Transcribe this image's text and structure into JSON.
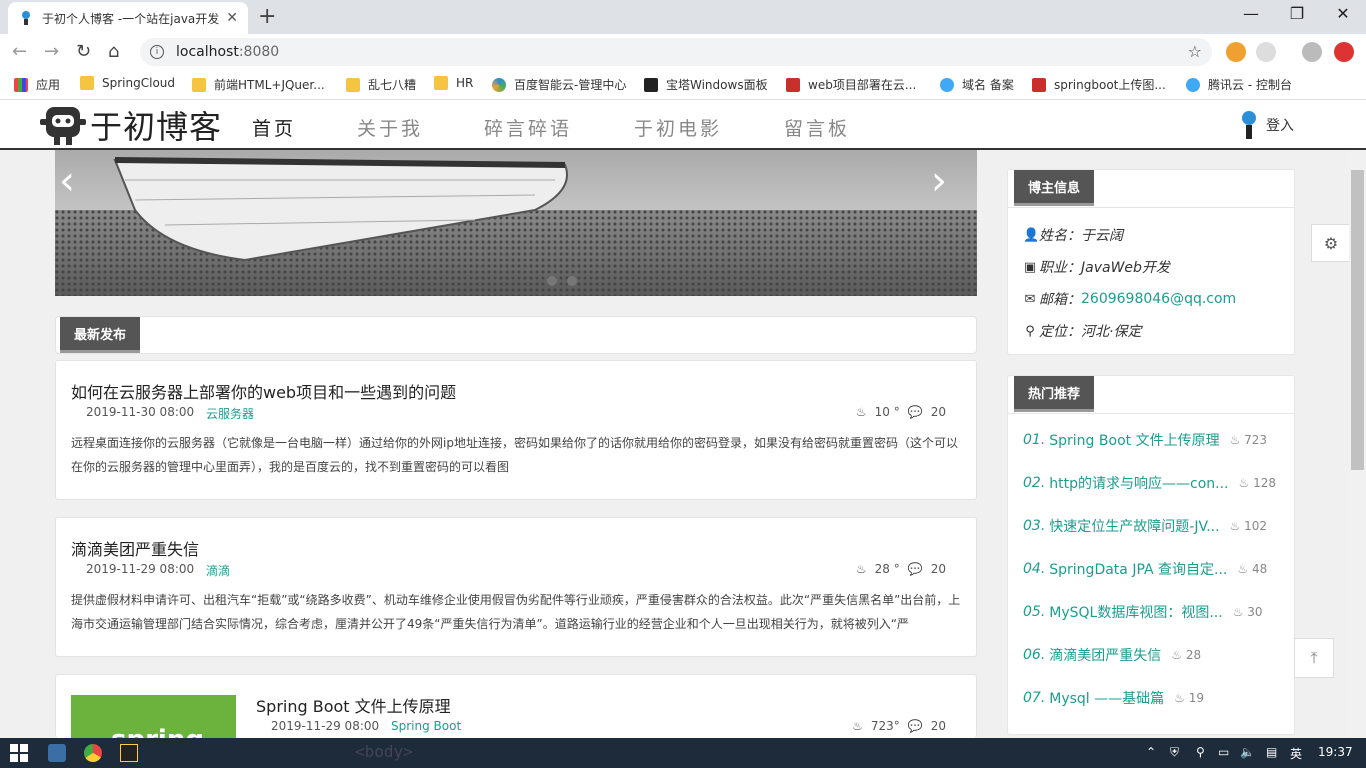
{
  "browser": {
    "tab_title": "于初个人博客 -一个站在java开发",
    "url_host": "localhost",
    "url_port": ":8080",
    "bookmarks": [
      {
        "label": "应用",
        "icon": "apps-grid-icon"
      },
      {
        "label": "SpringCloud",
        "icon": "folder-icon"
      },
      {
        "label": "前端HTML+JQuer...",
        "icon": "folder-icon"
      },
      {
        "label": "乱七八糟",
        "icon": "folder-icon"
      },
      {
        "label": "HR",
        "icon": "folder-icon"
      },
      {
        "label": "百度智能云-管理中心",
        "icon": "baidu-cloud-icon"
      },
      {
        "label": "宝塔Windows面板",
        "icon": "bt-icon"
      },
      {
        "label": "web项目部署在云...",
        "icon": "csdn-icon"
      },
      {
        "label": "域名 备案",
        "icon": "cloud-icon"
      },
      {
        "label": "springboot上传图...",
        "icon": "csdn-icon"
      },
      {
        "label": "腾讯云 - 控制台",
        "icon": "cloud-icon"
      }
    ]
  },
  "site": {
    "logo_text": "于初博客",
    "nav": [
      "首页",
      "关于我",
      "碎言碎语",
      "于初电影",
      "留言板"
    ],
    "login": "登入",
    "section_title": "最新发布",
    "articles": [
      {
        "title": "如何在云服务器上部署你的web项目和一些遇到的问题",
        "date": "2019-11-30 08:00",
        "category": "云服务器",
        "views": "10 °",
        "comments": "20",
        "body": "远程桌面连接你的云服务器（它就像是一台电脑一样）通过给你的外网ip地址连接，密码如果给你了的话你就用给你的密码登录，如果没有给密码就重置密码（这个可以在你的云服务器的管理中心里面弄），我的是百度云的，找不到重置密码的可以看图"
      },
      {
        "title": "滴滴美团严重失信",
        "date": "2019-11-29 08:00",
        "category": "滴滴",
        "views": "28 °",
        "comments": "20",
        "body": "提供虚假材料申请许可、出租汽车“拒载”或“绕路多收费”、机动车维修企业使用假冒伪劣配件等行业顽疾，严重侵害群众的合法权益。此次“严重失信黑名单”出台前，上海市交通运输管理部门结合实际情况，综合考虑，厘清并公开了49条“严重失信行为清单”。道路运输行业的经营企业和个人一旦出现相关行为，就将被列入“严"
      },
      {
        "title": "Spring Boot 文件上传原理",
        "date": "2019-11-29 08:00",
        "category": "Spring Boot",
        "views": "723°",
        "comments": "20",
        "thumb_text": "spring"
      }
    ]
  },
  "sidebar": {
    "blogger_title": "博主信息",
    "info": [
      {
        "icon": "user-icon",
        "text": "姓名：于云阔"
      },
      {
        "icon": "idcard-icon",
        "text": "职业：JavaWeb开发"
      },
      {
        "icon": "mail-icon",
        "text": "邮箱：",
        "link": "2609698046@qq.com"
      },
      {
        "icon": "location-icon",
        "text": "定位：河北·保定"
      }
    ],
    "hot_title": "热门推荐",
    "hot": [
      {
        "num": "01.",
        "text": "Spring Boot 文件上传原理",
        "count": "723"
      },
      {
        "num": "02.",
        "text": "http的请求与响应——con...",
        "count": "128"
      },
      {
        "num": "03.",
        "text": "快速定位生产故障问题-JV...",
        "count": "102"
      },
      {
        "num": "04.",
        "text": "SpringData JPA 查询自定...",
        "count": "48"
      },
      {
        "num": "05.",
        "text": "MySQL数据库视图：视图...",
        "count": "30"
      },
      {
        "num": "06.",
        "text": "滴滴美团严重失信",
        "count": "28"
      },
      {
        "num": "07.",
        "text": "Mysql ——基础篇",
        "count": "19"
      }
    ]
  },
  "taskbar": {
    "ghost_text": "<body>",
    "ime": "英",
    "clock": "19:37"
  }
}
